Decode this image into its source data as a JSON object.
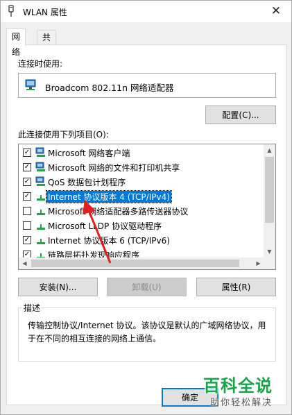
{
  "window": {
    "title": "WLAN 属性",
    "close_glyph": "✕"
  },
  "tabs": [
    {
      "label": "网络",
      "active": true
    },
    {
      "label": "共享",
      "active": false
    }
  ],
  "connect_using": {
    "label": "连接时使用:",
    "adapter": "Broadcom 802.11n 网络适配器",
    "adapter_icon": "network-adapter-icon"
  },
  "configure_button": "配置(C)...",
  "items_label": "此连接使用下列项目(O):",
  "items": [
    {
      "checked": true,
      "icon": "network-client-icon",
      "text": "Microsoft 网络客户端",
      "selected": false
    },
    {
      "checked": true,
      "icon": "network-client-icon",
      "text": "Microsoft 网络的文件和打印机共享",
      "selected": false
    },
    {
      "checked": true,
      "icon": "network-client-icon",
      "text": "QoS 数据包计划程序",
      "selected": false
    },
    {
      "checked": true,
      "icon": "protocol-icon",
      "text": "Internet 协议版本 4 (TCP/IPv4)",
      "selected": true
    },
    {
      "checked": false,
      "icon": "protocol-icon",
      "text": "Microsoft 网络适配器多路传送器协议",
      "selected": false
    },
    {
      "checked": false,
      "icon": "protocol-icon",
      "text": "Microsoft LLDP 协议驱动程序",
      "selected": false
    },
    {
      "checked": true,
      "icon": "protocol-icon",
      "text": "Internet 协议版本 6 (TCP/IPv6)",
      "selected": false
    },
    {
      "checked": true,
      "icon": "protocol-icon",
      "text": "链路层拓扑发现响应程序",
      "selected": false
    }
  ],
  "buttons": {
    "install": "安装(N)...",
    "uninstall": "卸载(U)",
    "properties": "属性(R)"
  },
  "description": {
    "legend": "描述",
    "text": "传输控制协议/Internet 协议。该协议是默认的广域网络协议，用于在不同的相互连接的网络上通信。"
  },
  "ok_button": "确定",
  "watermark": {
    "big": "百科全说",
    "small": "助你轻松解决"
  },
  "colors": {
    "selection": "#0078d7",
    "arrow": "#e02020",
    "watermark": "#1aa34a"
  }
}
